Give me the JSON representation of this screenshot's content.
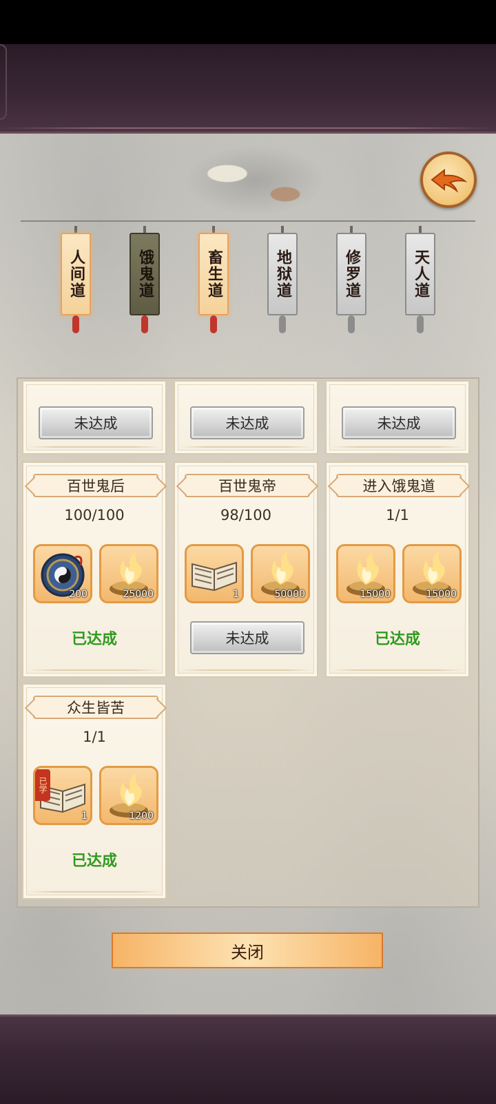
{
  "paths": [
    {
      "label": "人间道",
      "state": "lit"
    },
    {
      "label": "饿鬼道",
      "state": "active"
    },
    {
      "label": "畜生道",
      "state": "lit"
    },
    {
      "label": "地狱道",
      "state": "grey"
    },
    {
      "label": "修罗道",
      "state": "grey"
    },
    {
      "label": "天人道",
      "state": "grey"
    }
  ],
  "top_row": [
    {
      "status": "未达成"
    },
    {
      "status": "未达成"
    },
    {
      "status": "未达成"
    }
  ],
  "achievements": [
    {
      "title": "百世鬼后",
      "progress": "100/100",
      "rewards": [
        {
          "icon": "yinyang-compass-icon",
          "qty": "200"
        },
        {
          "icon": "spirit-fire-icon",
          "qty": "25000"
        }
      ],
      "status": "已达成",
      "done": true
    },
    {
      "title": "百世鬼帝",
      "progress": "98/100",
      "rewards": [
        {
          "icon": "book-icon",
          "qty": "1"
        },
        {
          "icon": "spirit-fire-icon",
          "qty": "50000"
        }
      ],
      "status": "未达成",
      "done": false
    },
    {
      "title": "进入饿鬼道",
      "progress": "1/1",
      "rewards": [
        {
          "icon": "spirit-fire-icon",
          "qty": "15000"
        },
        {
          "icon": "spirit-fire-icon",
          "qty": "15000"
        }
      ],
      "status": "已达成",
      "done": true
    },
    {
      "title": "众生皆苦",
      "progress": "1/1",
      "rewards": [
        {
          "icon": "book-icon",
          "qty": "1",
          "badge": "已学"
        },
        {
          "icon": "spirit-fire-icon",
          "qty": "1200"
        }
      ],
      "status": "已达成",
      "done": true
    }
  ],
  "close_label": "关闭",
  "colors": {
    "done": "#2f9a1e",
    "accent": "#e39a44"
  }
}
